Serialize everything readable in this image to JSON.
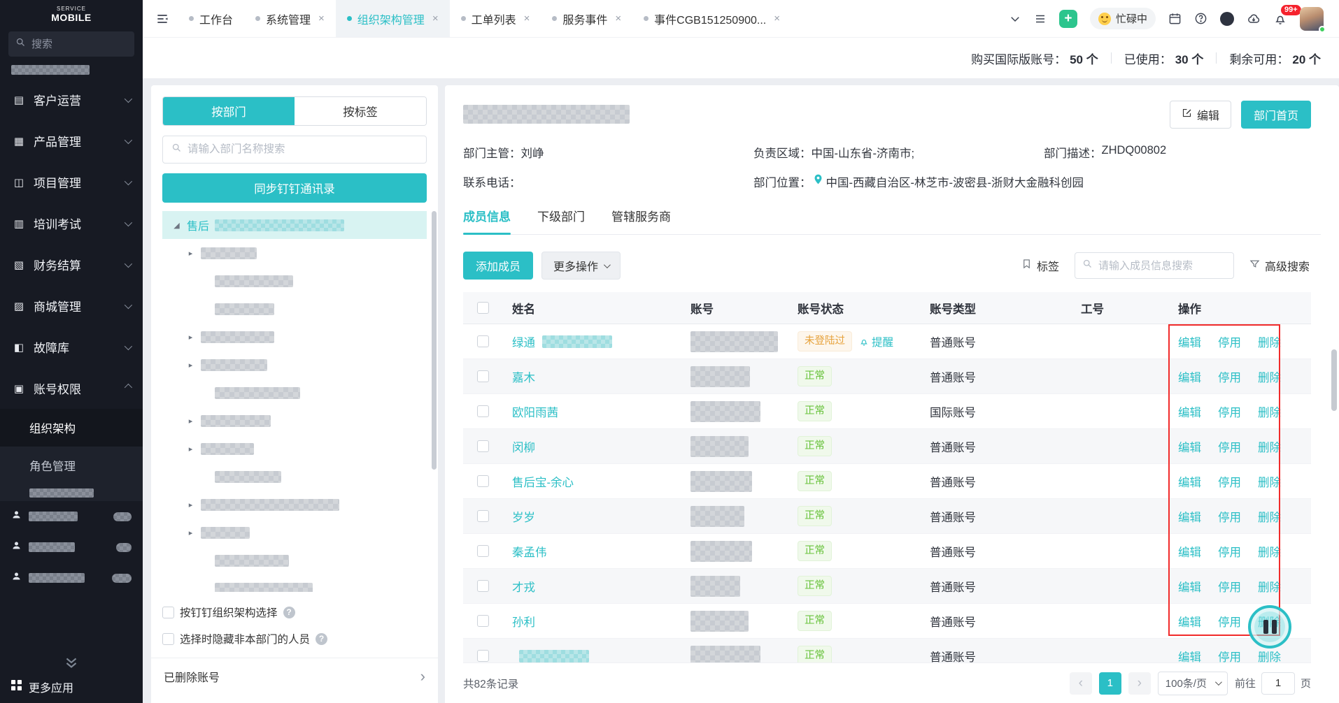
{
  "colors": {
    "accent": "#2bbfc6",
    "annotation_red": "#f12b2b",
    "warning": "#e6a23c",
    "success": "#67c23a"
  },
  "sidebar": {
    "logo_sub": "SERVICE",
    "logo_text": "MOBILE",
    "search_placeholder": "搜索",
    "menu": [
      {
        "id": "customer-ops",
        "icon": "customer-ops-icon",
        "glyph": "▤",
        "label": "客户运营"
      },
      {
        "id": "product-mgmt",
        "icon": "product-mgmt-icon",
        "glyph": "▦",
        "label": "产品管理"
      },
      {
        "id": "project-mgmt",
        "icon": "project-mgmt-icon",
        "glyph": "◫",
        "label": "项目管理"
      },
      {
        "id": "training-exam",
        "icon": "training-exam-icon",
        "glyph": "▥",
        "label": "培训考试"
      },
      {
        "id": "finance-settle",
        "icon": "finance-settle-icon",
        "glyph": "▧",
        "label": "财务结算"
      },
      {
        "id": "mall-mgmt",
        "icon": "mall-mgmt-icon",
        "glyph": "▨",
        "label": "商城管理"
      },
      {
        "id": "fault-lib",
        "icon": "fault-lib-icon",
        "glyph": "◧",
        "label": "故障库"
      },
      {
        "id": "account-perm",
        "icon": "account-perm-icon",
        "glyph": "▣",
        "label": "账号权限",
        "expanded": true
      }
    ],
    "submenu": [
      {
        "id": "org-structure",
        "label": "组织架构",
        "active": true
      },
      {
        "id": "role-mgmt",
        "label": "角色管理",
        "active": false
      }
    ],
    "more_apps": "更多应用"
  },
  "tabbar": {
    "tabs": [
      {
        "label": "工作台",
        "closable": false,
        "active": false
      },
      {
        "label": "系统管理",
        "closable": true,
        "active": false
      },
      {
        "label": "组织架构管理",
        "closable": true,
        "active": true
      },
      {
        "label": "工单列表",
        "closable": true,
        "active": false
      },
      {
        "label": "服务事件",
        "closable": true,
        "active": false
      },
      {
        "label": "事件CGB151250900...",
        "closable": true,
        "active": false
      }
    ],
    "status_label": "忙碌中",
    "badge_count": "99+"
  },
  "statsbar": {
    "items": [
      {
        "label": "购买国际版账号：",
        "value": "50 个"
      },
      {
        "label": "已使用：",
        "value": "30 个"
      },
      {
        "label": "剩余可用：",
        "value": "20 个"
      }
    ]
  },
  "dept_panel": {
    "tab_by_dept": "按部门",
    "tab_by_tag": "按标签",
    "search_placeholder": "请输入部门名称搜索",
    "sync_button": "同步钉钉通讯录",
    "tree": [
      {
        "indent": 0,
        "arrow": "open",
        "label": "售后",
        "blur": 185,
        "selected": true
      },
      {
        "indent": 1,
        "arrow": "right",
        "blur": 80
      },
      {
        "indent": 2,
        "blur": 112
      },
      {
        "indent": 2,
        "blur": 85
      },
      {
        "indent": 1,
        "arrow": "right",
        "blur": 105
      },
      {
        "indent": 1,
        "arrow": "right",
        "blur": 95
      },
      {
        "indent": 2,
        "blur": 122
      },
      {
        "indent": 1,
        "arrow": "right",
        "blur": 100
      },
      {
        "indent": 1,
        "arrow": "right",
        "blur": 76
      },
      {
        "indent": 2,
        "blur": 95
      },
      {
        "indent": 1,
        "arrow": "right",
        "blur": 198
      },
      {
        "indent": 1,
        "arrow": "right",
        "blur": 70
      },
      {
        "indent": 2,
        "blur": 106
      },
      {
        "indent": 2,
        "blur": 140
      },
      {
        "indent": 1,
        "blur": 120
      }
    ],
    "checkbox1": "按钉钉组织架构选择",
    "checkbox2": "选择时隐藏非本部门的人员",
    "deleted_accounts": "已删除账号"
  },
  "detail": {
    "edit_button": "编辑",
    "home_button": "部门首页",
    "info": [
      {
        "label": "部门主管：",
        "value": "刘峥"
      },
      {
        "label": "负责区域：",
        "value": "中国-山东省-济南市;"
      },
      {
        "label": "部门描述：",
        "value": "ZHDQ00802"
      },
      {
        "label": "联系电话：",
        "value": ""
      },
      {
        "label": "部门位置：",
        "value": "中国-西藏自治区-林芝市-波密县-浙财大金融科创园",
        "pin": true
      }
    ],
    "tabs": [
      "成员信息",
      "下级部门",
      "管辖服务商"
    ],
    "add_member": "添加成员",
    "more_actions": "更多操作",
    "tag_label": "标签",
    "member_search_placeholder": "请输入成员信息搜索",
    "advanced_search": "高级搜索",
    "table": {
      "headers": [
        "姓名",
        "账号",
        "账号状态",
        "账号类型",
        "工号",
        "操作"
      ],
      "actions": [
        "编辑",
        "停用",
        "删除"
      ],
      "remind": "提醒",
      "rows": [
        {
          "name": "绿通",
          "name_blur": true,
          "acct_w": 150,
          "status": "未登陆过",
          "status_kind": "warning",
          "remind": true,
          "type": "普通账号"
        },
        {
          "name": "嘉木",
          "acct_w": 85,
          "status": "正常",
          "status_kind": "success",
          "type": "普通账号"
        },
        {
          "name": "欧阳雨茜",
          "acct_w": 100,
          "status": "正常",
          "status_kind": "success",
          "type": "国际账号"
        },
        {
          "name": "闵柳",
          "acct_w": 83,
          "status": "正常",
          "status_kind": "success",
          "type": "普通账号"
        },
        {
          "name": "售后宝-余心",
          "acct_w": 88,
          "status": "正常",
          "status_kind": "success",
          "type": "普通账号"
        },
        {
          "name": "岁岁",
          "acct_w": 77,
          "status": "正常",
          "status_kind": "success",
          "type": "普通账号"
        },
        {
          "name": "秦孟伟",
          "acct_w": 88,
          "status": "正常",
          "status_kind": "success",
          "type": "普通账号"
        },
        {
          "name": "才戎",
          "acct_w": 71,
          "status": "正常",
          "status_kind": "success",
          "type": "普通账号"
        },
        {
          "name": "孙利",
          "acct_w": 83,
          "status": "正常",
          "status_kind": "success",
          "type": "普通账号"
        },
        {
          "name": "",
          "name_blur": true,
          "acct_w": 100,
          "status": "正常",
          "status_kind": "success",
          "type": "普通账号",
          "partial": true
        }
      ]
    },
    "footer": {
      "total": "共82条记录",
      "page": "1",
      "page_size": "100条/页",
      "goto_label": "前往",
      "goto_value": "1",
      "page_unit": "页"
    }
  }
}
